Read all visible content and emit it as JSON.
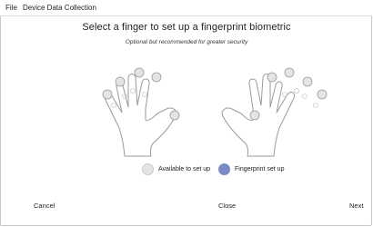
{
  "menubar": {
    "file_label": "File",
    "device_label": "Device Data Collection"
  },
  "dialog": {
    "title": "Select a finger to set up a fingerprint biometric",
    "subtitle": "Optional but recommended for greater security"
  },
  "legend": [
    {
      "label": "Available to set up",
      "color": "#e4e4e4"
    },
    {
      "label": "Fingerprint set up",
      "color": "#7b8ac4"
    }
  ],
  "footer": {
    "cancel_label": "Cancel",
    "close_label": "Close",
    "next_label": "Next"
  },
  "colors": {
    "available": "#e4e4e4",
    "setup": "#7b8ac4",
    "outline": "#9a9a9a"
  }
}
